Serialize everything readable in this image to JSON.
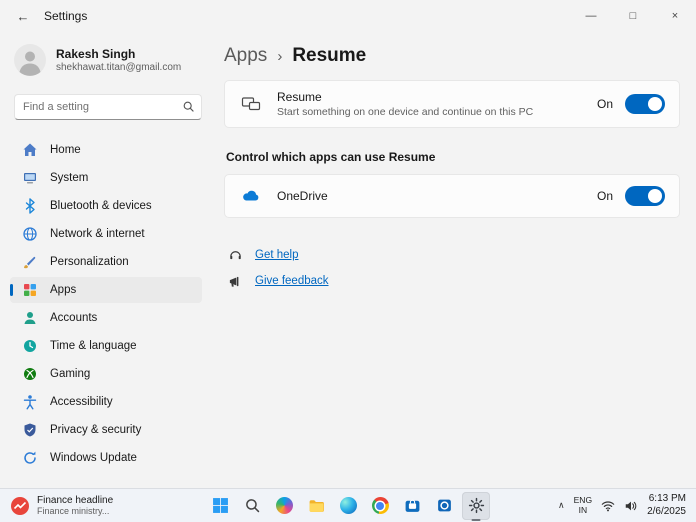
{
  "icons": {
    "back": "←",
    "minimize": "—",
    "maximize": "□",
    "close": "×",
    "breadcrumb_separator": "›",
    "tray_chevron": "∧"
  },
  "titlebar": {
    "title": "Settings"
  },
  "sidebar": {
    "user": {
      "name": "Rakesh Singh",
      "email": "shekhawat.titan@gmail.com"
    },
    "search_placeholder": "Find a setting",
    "selected": "Apps",
    "items": [
      {
        "label": "Home"
      },
      {
        "label": "System"
      },
      {
        "label": "Bluetooth & devices"
      },
      {
        "label": "Network & internet"
      },
      {
        "label": "Personalization"
      },
      {
        "label": "Apps"
      },
      {
        "label": "Accounts"
      },
      {
        "label": "Time & language"
      },
      {
        "label": "Gaming"
      },
      {
        "label": "Accessibility"
      },
      {
        "label": "Privacy & security"
      },
      {
        "label": "Windows Update"
      }
    ]
  },
  "main": {
    "breadcrumb": {
      "parent": "Apps",
      "current": "Resume"
    },
    "resume": {
      "title": "Resume",
      "description": "Start something on one device and continue on this PC",
      "state": "On"
    },
    "section_title": "Control which apps can use Resume",
    "onedrive": {
      "title": "OneDrive",
      "state": "On"
    },
    "links": {
      "get_help": "Get help",
      "give_feedback": "Give feedback"
    }
  },
  "taskbar": {
    "widget": {
      "headline": "Finance headline",
      "subline": "Finance ministry..."
    },
    "tray": {
      "language": "ENG",
      "region": "IN",
      "time": "6:13 PM",
      "date": "2/6/2025"
    }
  },
  "colors": {
    "accent": "#0067c0",
    "link": "#0067c0",
    "toggle_on": "#0067c0"
  }
}
